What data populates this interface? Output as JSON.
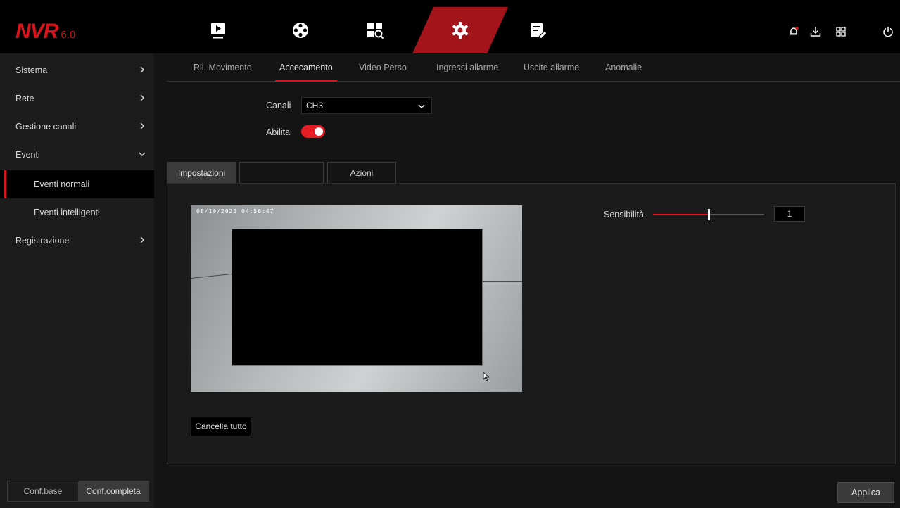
{
  "app": {
    "logo_main": "NVR",
    "logo_version": "6.0"
  },
  "top_nav": [
    {
      "icon": "playback-icon"
    },
    {
      "icon": "film-reel-icon"
    },
    {
      "icon": "search-grid-icon"
    },
    {
      "icon": "settings-gear-icon",
      "active": true
    },
    {
      "icon": "maintenance-icon"
    }
  ],
  "top_right_icons": [
    "alarm-bell-icon",
    "download-icon",
    "multiscreen-icon",
    "power-icon"
  ],
  "sidebar": {
    "items": [
      {
        "label": "Sistema"
      },
      {
        "label": "Rete"
      },
      {
        "label": "Gestione canali"
      },
      {
        "label": "Eventi"
      },
      {
        "label": "Eventi normali"
      },
      {
        "label": "Eventi intelligenti"
      },
      {
        "label": "Registrazione"
      }
    ],
    "conf_base": "Conf.base",
    "conf_full": "Conf.completa"
  },
  "tabs": [
    {
      "label": "Ril. Movimento"
    },
    {
      "label": "Accecamento"
    },
    {
      "label": "Video Perso"
    },
    {
      "label": "Ingressi allarme"
    },
    {
      "label": "Uscite allarme"
    },
    {
      "label": "Anomalie"
    }
  ],
  "form": {
    "channel_label": "Canali",
    "channel_value": "CH3",
    "enable_label": "Abilita",
    "enabled": true
  },
  "subtabs": [
    {
      "label": "Impostazioni"
    },
    {
      "label": ""
    },
    {
      "label": "Azioni"
    }
  ],
  "preview": {
    "timestamp": "08/10/2023 04:56:47"
  },
  "sensitivity": {
    "label": "Sensibilità",
    "value": "1",
    "fraction": 0.5
  },
  "buttons": {
    "clear_all": "Cancella tutto",
    "apply": "Applica"
  },
  "colors": {
    "accent": "#d8141c",
    "toggle_on": "#e41c23",
    "background": "#141414",
    "sidebar": "#1c1c1c"
  }
}
